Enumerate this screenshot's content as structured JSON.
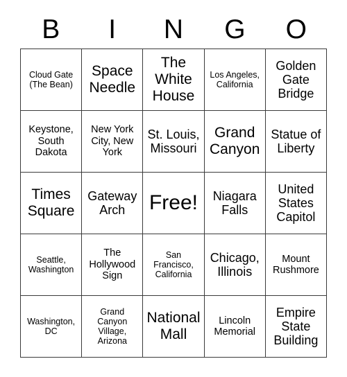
{
  "card": {
    "header_letters": [
      "B",
      "I",
      "N",
      "G",
      "O"
    ],
    "rows": [
      [
        {
          "text": "Cloud Gate (The Bean)",
          "size": "xs"
        },
        {
          "text": "Space Needle",
          "size": "lg"
        },
        {
          "text": "The White House",
          "size": "lg"
        },
        {
          "text": "Los Angeles, California",
          "size": "xs"
        },
        {
          "text": "Golden Gate Bridge",
          "size": "md"
        }
      ],
      [
        {
          "text": "Keystone, South Dakota",
          "size": "sm"
        },
        {
          "text": "New York City, New York",
          "size": "sm"
        },
        {
          "text": "St. Louis, Missouri",
          "size": "md"
        },
        {
          "text": "Grand Canyon",
          "size": "lg"
        },
        {
          "text": "Statue of Liberty",
          "size": "md"
        }
      ],
      [
        {
          "text": "Times Square",
          "size": "lg"
        },
        {
          "text": "Gateway Arch",
          "size": "md"
        },
        {
          "text": "Free!",
          "size": "xl"
        },
        {
          "text": "Niagara Falls",
          "size": "md"
        },
        {
          "text": "United States Capitol",
          "size": "md"
        }
      ],
      [
        {
          "text": "Seattle, Washington",
          "size": "xs"
        },
        {
          "text": "The Hollywood Sign",
          "size": "sm"
        },
        {
          "text": "San Francisco, California",
          "size": "xs"
        },
        {
          "text": "Chicago, Illinois",
          "size": "md"
        },
        {
          "text": "Mount Rushmore",
          "size": "sm"
        }
      ],
      [
        {
          "text": "Washington, DC",
          "size": "xs"
        },
        {
          "text": "Grand Canyon Village, Arizona",
          "size": "xs"
        },
        {
          "text": "National Mall",
          "size": "lg"
        },
        {
          "text": "Lincoln Memorial",
          "size": "sm"
        },
        {
          "text": "Empire State Building",
          "size": "md"
        }
      ]
    ]
  },
  "colors": {
    "background": "#ffffff",
    "border": "#3a3a3a",
    "text": "#000000"
  }
}
